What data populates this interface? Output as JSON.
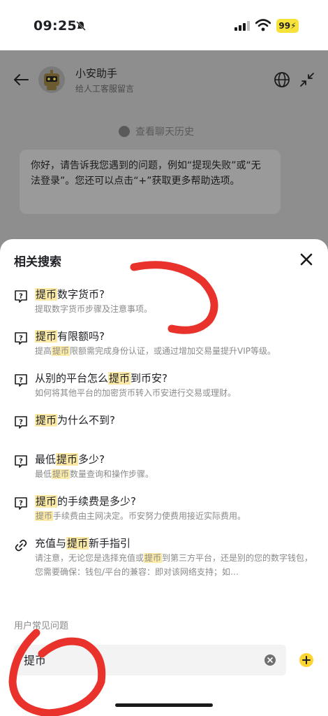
{
  "status_bar": {
    "time": "09:25",
    "battery": "99"
  },
  "header": {
    "title": "小安助手",
    "subtitle": "给人工客服留言"
  },
  "chat": {
    "history_link": "查看聊天历史",
    "bot_message": "你好，请告诉我您遇到的问题，例如“提现失败”或“无法登录”。您还可以点击“+”获取更多帮助选项。"
  },
  "sheet": {
    "title": "相关搜索",
    "results": [
      {
        "title_parts": [
          "",
          "提币",
          "数字货币?"
        ],
        "desc_parts": [
          "提取数字货币步骤及注意事项。",
          "",
          ""
        ]
      },
      {
        "title_parts": [
          "",
          "提币",
          "有限额吗?"
        ],
        "desc_parts": [
          "提高",
          "提币",
          "限额需完成身份认证，或通过增加交易量提升VIP等级。"
        ]
      },
      {
        "title_parts": [
          "从别的平台怎么",
          "提币",
          "到币安?"
        ],
        "desc_parts": [
          "如何将其他平台的加密货币转入币安进行交易或理财。",
          "",
          ""
        ]
      },
      {
        "title_parts": [
          "",
          "提币",
          "为什么不到?"
        ],
        "desc_parts": [
          "",
          "",
          ""
        ]
      },
      {
        "title_parts": [
          "最低",
          "提币",
          "多少?"
        ],
        "desc_parts": [
          "最低",
          "提币",
          "数量查询和操作步骤。"
        ]
      },
      {
        "title_parts": [
          "",
          "提币",
          "的手续费是多少?"
        ],
        "desc_parts": [
          "",
          "提币",
          "手续费由主网决定。币安努力使费用接近实际费用。"
        ]
      },
      {
        "title_parts": [
          "充值与",
          "提币",
          "新手指引"
        ],
        "desc_parts": [
          "请注意，无论您是选择充值或",
          "提币",
          "到第三方平台，还是别的您的数字钱包，您需要确保：钱包/平台的兼容：即对该网络支持；如…"
        ]
      }
    ],
    "section_peek": "用户常见问题"
  },
  "input": {
    "value": "提币"
  },
  "colors": {
    "accent": "#fcd535",
    "highlight": "#fbe9a6",
    "marker": "#e8322b"
  }
}
